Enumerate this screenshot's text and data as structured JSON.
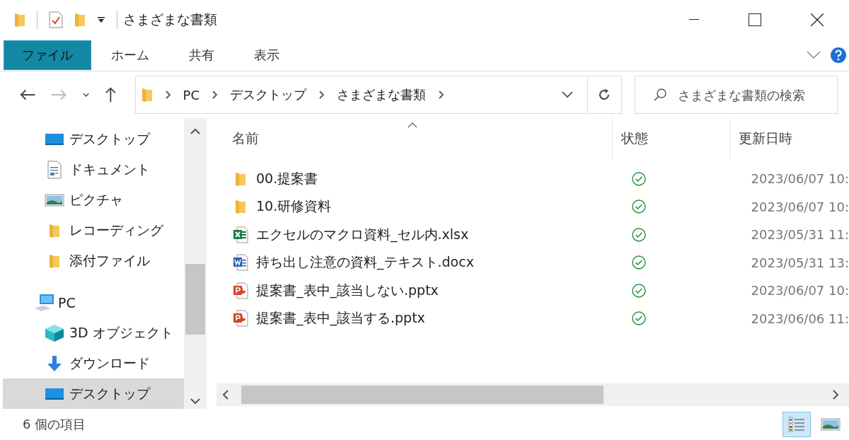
{
  "window": {
    "title": "さまざまな書類"
  },
  "ribbon_tabs": [
    {
      "label": "ファイル",
      "selected": true
    },
    {
      "label": "ホーム",
      "selected": false
    },
    {
      "label": "共有",
      "selected": false
    },
    {
      "label": "表示",
      "selected": false
    }
  ],
  "breadcrumb": [
    "PC",
    "デスクトップ",
    "さまざまな書類"
  ],
  "search": {
    "placeholder": "さまざまな書類の検索"
  },
  "sidebar": {
    "quick_access": [
      {
        "label": "デスクトップ",
        "kind": "desktop",
        "selected": false
      },
      {
        "label": "ドキュメント",
        "kind": "document",
        "selected": false
      },
      {
        "label": "ピクチャ",
        "kind": "picture",
        "selected": false
      },
      {
        "label": "レコーディング",
        "kind": "folder",
        "selected": false
      },
      {
        "label": "添付ファイル",
        "kind": "folder",
        "selected": false
      }
    ],
    "pc": {
      "label": "PC",
      "children": [
        {
          "label": "3D オブジェクト",
          "kind": "cube",
          "selected": false
        },
        {
          "label": "ダウンロード",
          "kind": "download",
          "selected": false
        },
        {
          "label": "デスクトップ",
          "kind": "desktop",
          "selected": true
        }
      ]
    }
  },
  "table": {
    "columns": [
      "名前",
      "状態",
      "更新日時"
    ],
    "rows": [
      {
        "name": "00.提案書",
        "kind": "folder",
        "modified": "2023/06/07 10:"
      },
      {
        "name": "10.研修資料",
        "kind": "folder",
        "modified": "2023/06/07 10:"
      },
      {
        "name": "エクセルのマクロ資料_セル内.xlsx",
        "kind": "excel",
        "modified": "2023/05/31 11:"
      },
      {
        "name": "持ち出し注意の資料_テキスト.docx",
        "kind": "word",
        "modified": "2023/05/31 13:"
      },
      {
        "name": "提案書_表中_該当しない.pptx",
        "kind": "powerpoint",
        "modified": "2023/06/07 10:"
      },
      {
        "name": "提案書_表中_該当する.pptx",
        "kind": "powerpoint",
        "modified": "2023/06/06 11:"
      }
    ]
  },
  "status_bar": {
    "item_count": "6 個の項目",
    "views": [
      {
        "kind": "details",
        "selected": true
      },
      {
        "kind": "large-icons",
        "selected": false
      }
    ]
  }
}
